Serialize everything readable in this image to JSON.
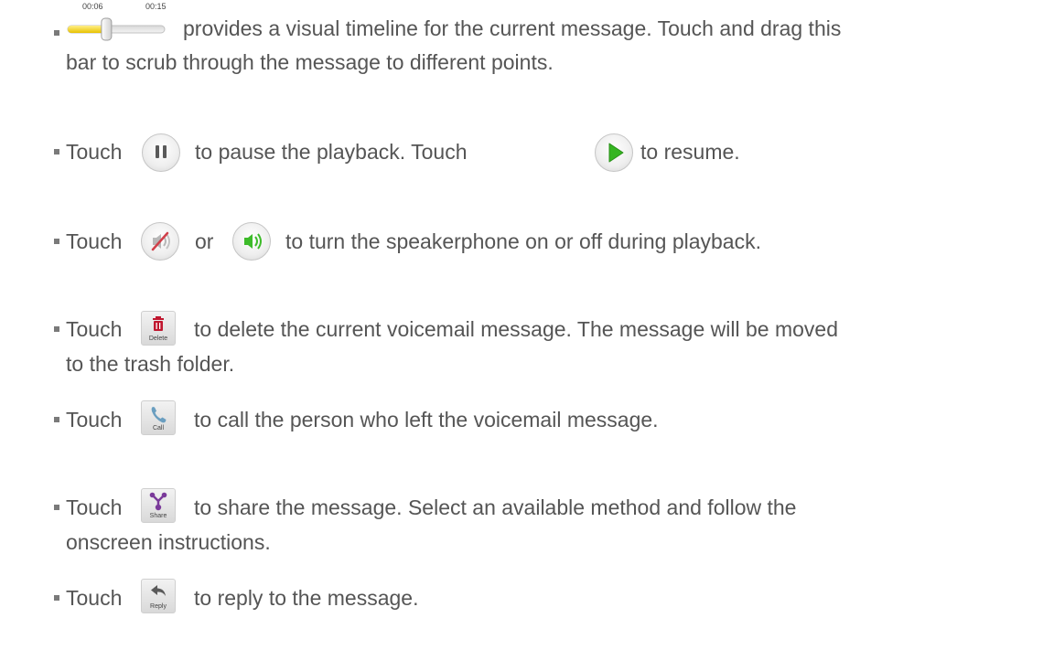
{
  "items": [
    {
      "icon": "playback-slider-icon",
      "line1": "provides a visual timeline for the current message. Touch and drag this",
      "line2": "bar to scrub through the message to different points."
    },
    {
      "prefix": "Touch",
      "icon1": "pause-icon",
      "mid": "to pause the playback. Touch",
      "icon2": "play-icon",
      "suffix": "to resume."
    },
    {
      "prefix": "Touch",
      "icon1": "speaker-off-icon",
      "mid": "or",
      "icon2": "speaker-on-icon",
      "suffix": "to turn the speakerphone on or off during playback."
    },
    {
      "prefix": "Touch",
      "icon": "delete-icon",
      "icon_caption": "Delete",
      "line1": "to delete the current voicemail message. The message will be moved",
      "line2": "to the trash folder."
    },
    {
      "prefix": "Touch",
      "icon": "call-icon",
      "icon_caption": "Call",
      "line1": "to call the person who left the voicemail message."
    },
    {
      "prefix": "Touch",
      "icon": "share-icon",
      "icon_caption": "Share",
      "line1": "to share the message. Select an available method and follow the",
      "line2": "onscreen instructions."
    },
    {
      "prefix": "Touch",
      "icon": "reply-icon",
      "icon_caption": "Reply",
      "line1": "to reply to the message."
    }
  ],
  "slider": {
    "elapsed": "00:06",
    "total": "00:15",
    "progress": 0.4
  },
  "colors": {
    "text": "#555555",
    "bullet": "#7a7a7a",
    "slider_fill": "#f5d000",
    "play_green": "#35b521",
    "speaker_green": "#3dbb2a",
    "delete_red": "#c0172f",
    "call_blue": "#6a9ec0",
    "share_purple": "#7a3a9a"
  }
}
